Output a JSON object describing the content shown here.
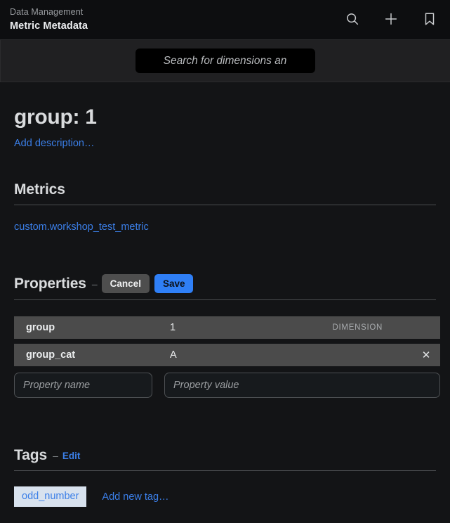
{
  "header": {
    "breadcrumb": "Data Management",
    "title": "Metric Metadata",
    "icons": [
      {
        "name": "search-icon"
      },
      {
        "name": "plus-icon"
      },
      {
        "name": "bookmark-icon"
      }
    ]
  },
  "search": {
    "placeholder": "Search for dimensions an",
    "value": ""
  },
  "entity": {
    "title": "group: 1",
    "add_description_label": "Add description…"
  },
  "metrics": {
    "heading": "Metrics",
    "items": [
      {
        "label": "custom.workshop_test_metric"
      }
    ]
  },
  "properties": {
    "heading": "Properties",
    "separator": "–",
    "cancel_label": "Cancel",
    "save_label": "Save",
    "rows": [
      {
        "name": "group",
        "value": "1",
        "badge": "DIMENSION",
        "removable": false
      },
      {
        "name": "group_cat",
        "value": "A",
        "badge": "",
        "removable": true
      }
    ],
    "new_name_placeholder": "Property name",
    "new_name_value": "",
    "new_value_placeholder": "Property value",
    "new_value_value": "",
    "remove_glyph": "✕"
  },
  "tags": {
    "heading": "Tags",
    "separator": "–",
    "edit_label": "Edit",
    "items": [
      {
        "label": "odd_number"
      }
    ],
    "add_label": "Add new tag…"
  },
  "colors": {
    "background": "#131416",
    "header_background": "#0d0e10",
    "search_strip": "#202022",
    "accent_blue": "#3b7fe8",
    "save_blue": "#2f7ff6",
    "row_gray": "#4b4b4b",
    "tag_background": "#d8e2ee"
  }
}
